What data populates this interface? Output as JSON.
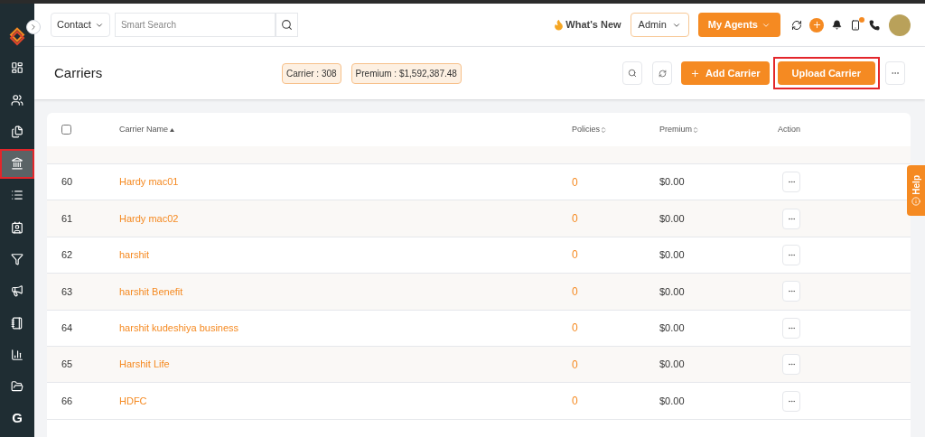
{
  "sidebar": {
    "items": [
      {
        "kind": "icon",
        "selected": false,
        "highlighted": false
      },
      {
        "kind": "icon",
        "selected": false,
        "highlighted": false
      },
      {
        "kind": "icon",
        "selected": false,
        "highlighted": false
      },
      {
        "kind": "icon",
        "selected": true,
        "highlighted": true
      },
      {
        "kind": "icon",
        "selected": false,
        "highlighted": false
      },
      {
        "kind": "icon",
        "selected": false,
        "highlighted": false
      },
      {
        "kind": "icon",
        "selected": false,
        "highlighted": false
      },
      {
        "kind": "icon",
        "selected": false,
        "highlighted": false
      },
      {
        "kind": "icon",
        "selected": false,
        "highlighted": false
      },
      {
        "kind": "icon",
        "selected": false,
        "highlighted": false
      },
      {
        "kind": "icon",
        "selected": false,
        "highlighted": false
      },
      {
        "kind": "letter",
        "label": "G",
        "selected": false,
        "highlighted": false
      }
    ]
  },
  "topbar": {
    "search_type": "Contact",
    "search": {
      "placeholder": "Smart Search"
    },
    "whats_new": "What's New",
    "role": "Admin",
    "agents_button": "My Agents",
    "notification_dot": true
  },
  "header": {
    "title": "Carriers",
    "badges": [
      "Carrier : 308",
      "Premium : $1,592,387.48"
    ],
    "add_button": "Add Carrier",
    "upload_button": {
      "label": "Upload Carrier",
      "highlighted": true
    }
  },
  "table": {
    "select_all": {
      "checked": false
    },
    "columns": [
      "Carrier Name",
      "Policies",
      "Premium",
      "Action"
    ],
    "rows": [
      {
        "number": "60",
        "name": "Hardy mac01",
        "policies": "0",
        "premium": "$0.00"
      },
      {
        "number": "61",
        "name": "Hardy mac02",
        "policies": "0",
        "premium": "$0.00"
      },
      {
        "number": "62",
        "name": "harshit",
        "policies": "0",
        "premium": "$0.00"
      },
      {
        "number": "63",
        "name": "harshit Benefit",
        "policies": "0",
        "premium": "$0.00"
      },
      {
        "number": "64",
        "name": "harshit kudeshiya business",
        "policies": "0",
        "premium": "$0.00"
      },
      {
        "number": "65",
        "name": "Harshit Life",
        "policies": "0",
        "premium": "$0.00"
      },
      {
        "number": "66",
        "name": "HDFC",
        "policies": "0",
        "premium": "$0.00"
      }
    ]
  },
  "help_tab": "Help"
}
